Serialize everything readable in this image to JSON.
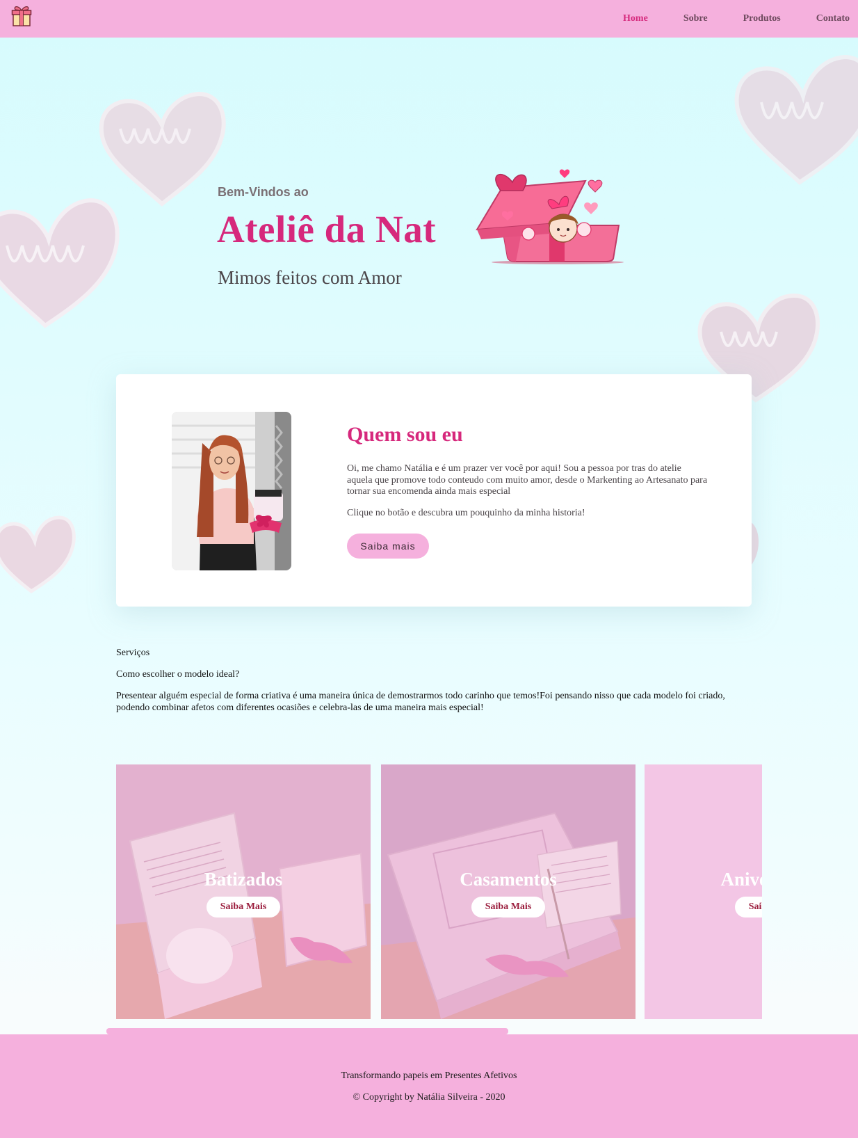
{
  "nav": {
    "logo_icon": "gift-icon",
    "items": [
      {
        "label": "Home",
        "active": true
      },
      {
        "label": "Sobre",
        "active": false
      },
      {
        "label": "Produtos",
        "active": false
      },
      {
        "label": "Contato",
        "active": false
      }
    ]
  },
  "hero": {
    "welcome": "Bem-Vindos ao",
    "title": "Ateliê da Nat",
    "subtitle": "Mimos feitos com Amor",
    "illustration": "girl-in-gift-box-illustration"
  },
  "about": {
    "title": "Quem sou eu",
    "text": "Oi, me chamo Natália e é um prazer ver você por aqui! Sou a pessoa por tras do atelie aquela que promove todo conteudo com muito amor, desde o Markenting ao Artesanato para tornar sua encomenda ainda mais especial",
    "cta_text": "Clique no botão e descubra um pouquinho da minha historia!",
    "button": "Saiba mais",
    "photo": "profile-photo"
  },
  "services": {
    "heading": "Serviços",
    "question": "Como escolher o modelo ideal?",
    "description": "Presentear alguém especial de forma criativa é uma maneira única de demostrarmos todo carinho que temos!Foi pensando nisso que cada modelo foi criado, podendo combinar afetos com diferentes ocasiões e celebra-las de uma maneira mais especial!",
    "tiles": [
      {
        "name": "Batizados",
        "button": "Saiba Mais"
      },
      {
        "name": "Casamentos",
        "button": "Saiba Mais"
      },
      {
        "name": "Aniversários",
        "button": "Saiba Mais"
      }
    ]
  },
  "footer": {
    "tagline": "Transformando papeis em Presentes Afetivos",
    "copyright": "© Copyright by Natália Silveira - 2020"
  },
  "colors": {
    "accent": "#d6287c",
    "pink": "#f5b0dd",
    "background": "#d6fbfd"
  }
}
